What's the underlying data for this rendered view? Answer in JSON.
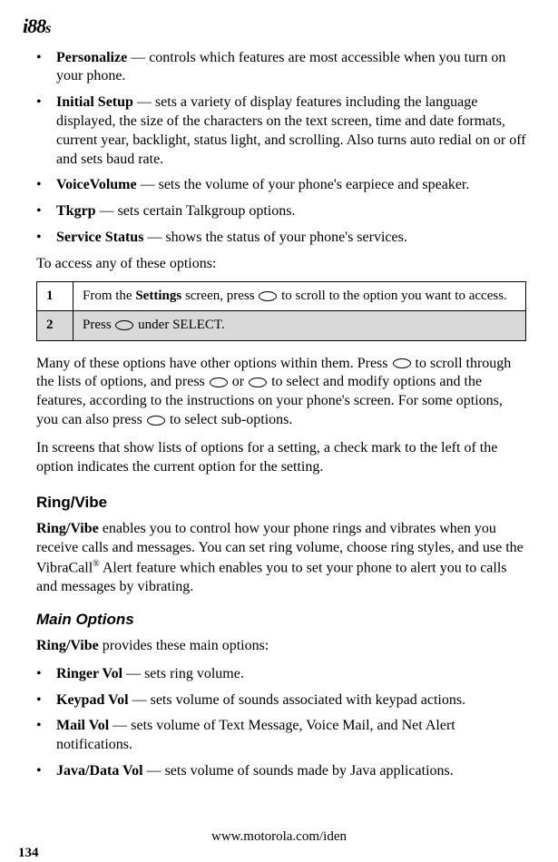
{
  "logo": "i88",
  "logo_suffix": "s",
  "topList": [
    {
      "term": "Personalize",
      "desc": " — controls which features are most accessible when you turn on your phone."
    },
    {
      "term": "Initial Setup",
      "desc": " — sets a variety of display features including the language displayed, the size of the characters on the text screen, time and date formats, current year, backlight, status light, and scrolling. Also turns auto redial on or off and sets baud rate."
    },
    {
      "term": "VoiceVolume",
      "desc": " — sets the volume of your phone's earpiece and speaker."
    },
    {
      "term": "Tkgrp",
      "desc": " — sets certain Talkgroup options."
    },
    {
      "term": "Service Status",
      "desc": " — shows the status of your phone's services."
    }
  ],
  "accessIntro": "To access any of these options:",
  "steps": {
    "row1": {
      "num": "1",
      "part1": "From the ",
      "boldPart": "Settings",
      "part2": " screen, press ",
      "part3": " to scroll to the option you want to access."
    },
    "row2": {
      "num": "2",
      "part1": "Press ",
      "part2": " under SELECT."
    }
  },
  "para1_a": "Many of these options have other options within them. Press ",
  "para1_b": " to scroll through the lists of options, and press ",
  "para1_c": " or ",
  "para1_d": " to select and modify options and the features, according to the instructions on your phone's screen. For some options, you can also press ",
  "para1_e": " to select sub-options.",
  "para2": "In screens that show lists of options for a setting, a check mark to the left of the option indicates the current option for the setting.",
  "ringVibeHeading": "Ring/Vibe",
  "ringVibePara_a": "Ring/Vibe",
  "ringVibePara_b": " enables you to control how your phone rings and vibrates when you receive calls and messages. You can set ring volume, choose ring styles, and use the VibraCall",
  "ringVibePara_c": " Alert feature which enables you to set your phone to alert you to calls and messages by vibrating.",
  "regMark": "®",
  "mainOptionsHeading": "Main Options",
  "mainOptionsIntro_a": "Ring/Vibe",
  "mainOptionsIntro_b": " provides these main options:",
  "mainOptionsList": [
    {
      "term": "Ringer Vol",
      "desc": " — sets ring volume."
    },
    {
      "term": "Keypad Vol",
      "desc": " — sets volume of sounds associated with keypad actions."
    },
    {
      "term": "Mail Vol",
      "desc": " — sets volume of Text Message, Voice Mail, and Net Alert notifications."
    },
    {
      "term": "Java/Data Vol",
      "desc": " — sets volume of sounds made by Java applications."
    }
  ],
  "footerUrl": "www.motorola.com/iden",
  "pageNum": "134"
}
